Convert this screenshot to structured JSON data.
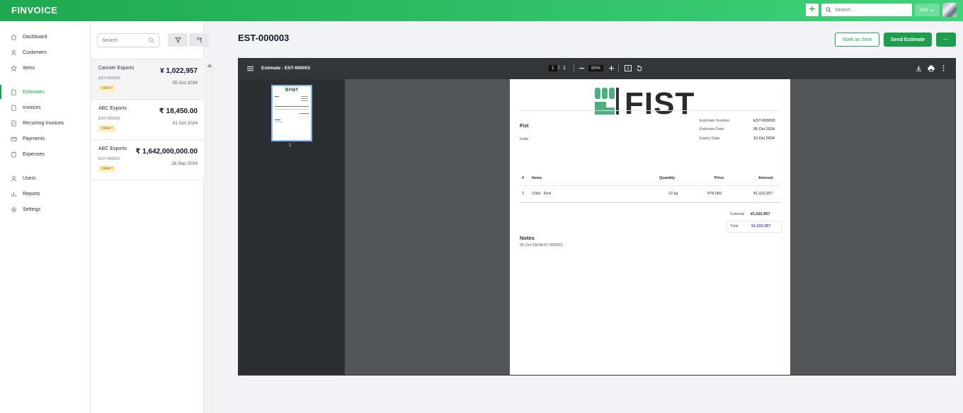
{
  "app": {
    "logo": "FINVOICE",
    "search_placeholder": "Search...",
    "company": "Fist"
  },
  "sidebar": {
    "items": [
      {
        "label": "Dashboard",
        "icon": "home-icon"
      },
      {
        "label": "Customers",
        "icon": "user-icon"
      },
      {
        "label": "Items",
        "icon": "star-icon"
      },
      {
        "label": "Estimates",
        "icon": "document-icon",
        "active": true
      },
      {
        "label": "Invoices",
        "icon": "file-icon"
      },
      {
        "label": "Recurring Invoices",
        "icon": "recurring-file-icon"
      },
      {
        "label": "Payments",
        "icon": "card-icon"
      },
      {
        "label": "Expenses",
        "icon": "clipboard-icon"
      },
      {
        "label": "Users",
        "icon": "users-icon"
      },
      {
        "label": "Reports",
        "icon": "chart-icon"
      },
      {
        "label": "Settings",
        "icon": "gear-icon"
      }
    ]
  },
  "list": {
    "search_placeholder": "Search",
    "estimates": [
      {
        "customer": "Cannier Exports",
        "number": "EST-000003",
        "amount": "¥ 1,022,957",
        "date": "05 Oct 2024",
        "status": "DRAFT"
      },
      {
        "customer": "ABC Exports",
        "number": "EST-000002",
        "amount": "₹ 18,450.00",
        "date": "01 Oct 2024",
        "status": "DRAFT"
      },
      {
        "customer": "ABC Exports",
        "number": "EST-000001",
        "amount": "₹ 1,642,000,000.00",
        "date": "26 Sep 2024",
        "status": "DRAFT"
      }
    ]
  },
  "main": {
    "title": "EST-000003",
    "mark_sent": "Mark as Sent",
    "send": "Send Estimate",
    "more": "···"
  },
  "viewer": {
    "doc_title": "Estimate - EST-000003",
    "page_current": "1",
    "page_sep": "/",
    "page_total": "1",
    "zoom": "50%",
    "thumb_label": "1"
  },
  "doc": {
    "brand": "FIST",
    "company": "Fist",
    "country": "India",
    "meta": [
      {
        "label": "Estimate Number",
        "value": "EST-000003"
      },
      {
        "label": "Estimate Date",
        "value": "05 Oct 2024"
      },
      {
        "label": "Expiry Date",
        "value": "10 Oct 2024"
      }
    ],
    "table_headers": {
      "num": "#",
      "items": "Items",
      "qty": "Quantity",
      "price": "Price",
      "amount": "Amount"
    },
    "rows": [
      {
        "num": "1",
        "item": "Chilli - Red",
        "qty": "13 kg",
        "price": "¥78,689",
        "amount": "¥1,022,957"
      }
    ],
    "subtotal_label": "Subtotal",
    "subtotal": "¥1,022,957",
    "total_label": "Total",
    "total": "¥1,022,957",
    "notes_title": "Notes",
    "notes": "05 Oct 2024EST-000003",
    "brand_color": "#4caf80"
  }
}
